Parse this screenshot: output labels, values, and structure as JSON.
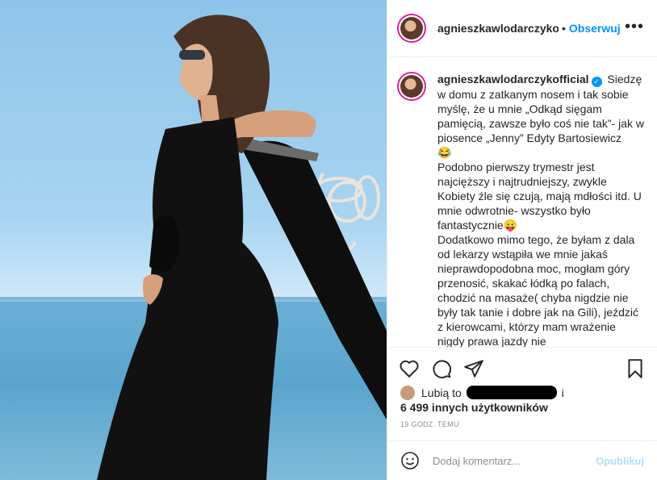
{
  "post": {
    "username": "agnieszkawlodarczykofficial",
    "username_header": "agnieszkawlodarczykof",
    "separator": "•",
    "follow_label": "Obserwuj",
    "more_label": "•••",
    "caption_parts": [
      "Siedzę w domu z zatkanym nosem i tak sobie myślę, że u mnie „Odkąd sięgam pamięcią, zawsze było coś nie tak”- jak w piosence „Jenny” Edyty Bartosiewicz",
      "😂",
      "Podobno pierwszy trymestr jest najcięższy i najtrudniejszy, zwykle Kobiety źle się czują, mają mdłości itd. U mnie odwrotnie- wszystko było fantastycznie",
      "😛",
      "Dodatkowo mimo tego, że byłam z dala od lekarzy wstąpiła we mnie jakaś nieprawdopodobna moc, mogłam góry przenosić, skakać łódką po falach, chodzić na masaże( chyba nigdzie nie były tak tanie i dobre jak na Gili), jeździć z kierowcami, którzy mam wrażenie nigdy prawa jazdy nie"
    ]
  },
  "likes": {
    "prefix": "Lubią to",
    "suffix": "i",
    "count_text": "6 499 innych użytkowników"
  },
  "time_ago": "19 GODZ. TEMU",
  "add_comment": {
    "placeholder": "Dodaj komentarz...",
    "post_label": "Opublikuj"
  },
  "icons": [
    "heart-icon",
    "comment-icon",
    "share-icon",
    "bookmark-icon",
    "emoji-icon"
  ],
  "colors": {
    "accent": "#0095f6",
    "muted": "#8e8e8e",
    "post_disabled": "#b2dffc"
  }
}
